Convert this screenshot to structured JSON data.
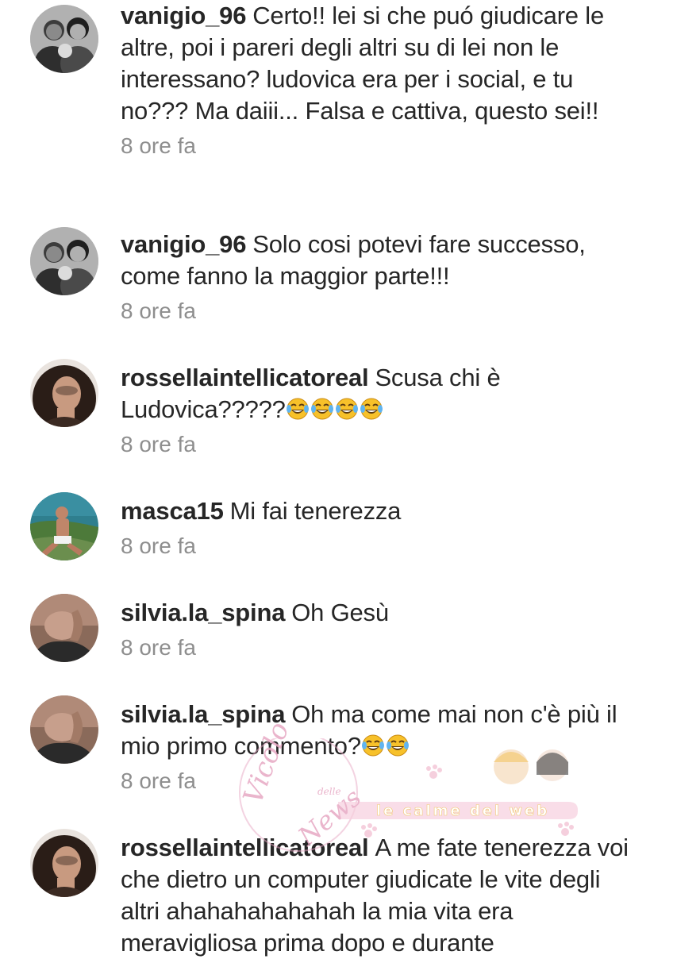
{
  "comments": [
    {
      "username": "vanigio_96",
      "text": "Certo!! lei si che puó giudicare le altre, poi i pareri degli altri su di lei non le interessano? ludovica era per i social,  e tu no??? Ma daiii... Falsa e cattiva,  questo sei!!",
      "emoji_count": 0,
      "time": "8 ore fa",
      "avatar": "couple-photo"
    },
    {
      "username": "vanigio_96",
      "text": "Solo cosi potevi fare successo, come fanno la maggior parte!!!",
      "emoji_count": 0,
      "time": "8 ore fa",
      "avatar": "couple-photo"
    },
    {
      "username": "rossellaintellicatoreal",
      "text": "Scusa chi è Ludovica?????",
      "emoji_count": 4,
      "emoji": "face-with-tears-of-joy",
      "time": "8 ore fa",
      "avatar": "woman-dark-hair"
    },
    {
      "username": "masca15",
      "text": "Mi fai tenerezza",
      "emoji_count": 0,
      "time": "8 ore fa",
      "avatar": "man-by-sea"
    },
    {
      "username": "silvia.la_spina",
      "text": "Oh Gesù",
      "emoji_count": 0,
      "time": "8 ore fa",
      "avatar": "woman-hand-on-neck"
    },
    {
      "username": "silvia.la_spina",
      "text": "Oh ma come mai non c'è più il mio primo commento?",
      "emoji_count": 2,
      "emoji": "face-with-tears-of-joy",
      "time": "8 ore fa",
      "avatar": "woman-hand-on-neck"
    },
    {
      "username": "rossellaintellicatoreal",
      "text": "A me fate tenerezza voi che dietro un computer giudicate le vite degli altri ahahahahahahah la mia vita era meravigliosa prima dopo e durante",
      "emoji_count": 0,
      "time": "",
      "avatar": "woman-dark-hair"
    }
  ],
  "watermark": {
    "script_line1": "Vicolo",
    "script_small": "delle",
    "script_line2": "News",
    "banner": "le calme del web"
  },
  "colors": {
    "username": "#262626",
    "text": "#262626",
    "timestamp": "#8e8e8e",
    "watermark_pink": "#e7a9c4",
    "watermark_banner": "#f7c7d9"
  }
}
